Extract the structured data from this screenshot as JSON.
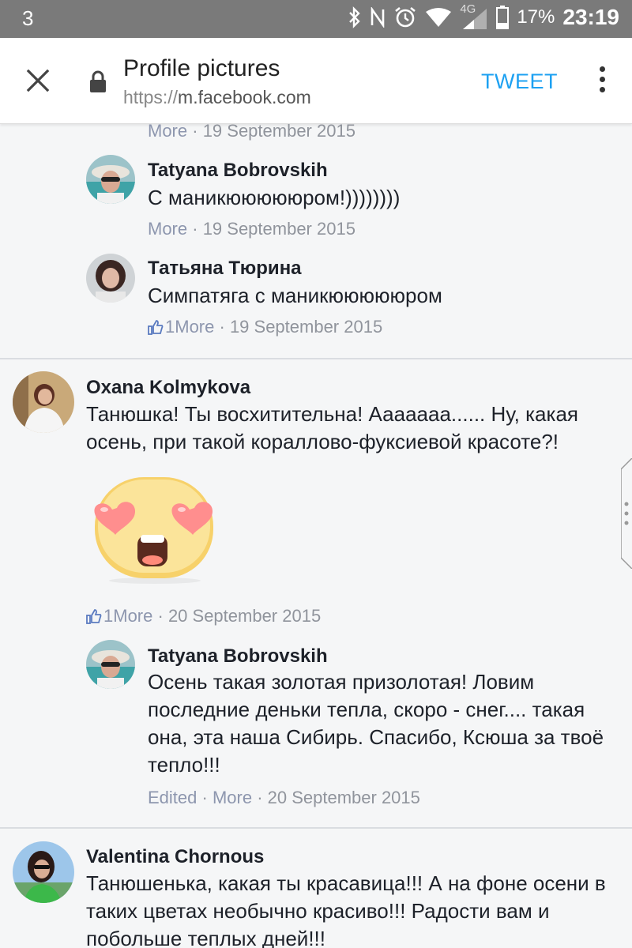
{
  "status_bar": {
    "notification_count": "3",
    "network": "4G",
    "battery": "17%",
    "time": "23:19"
  },
  "toolbar": {
    "title": "Profile pictures",
    "url_scheme": "https://",
    "url_host": "m.facebook.com",
    "tweet_label": "TWEET"
  },
  "comments": [
    {
      "meta_more": "More",
      "meta_date": "19 September 2015"
    },
    {
      "author": "Tatyana Bobrovskih",
      "text": "С маникюююююром!))))))))",
      "meta_more": "More",
      "meta_date": "19 September 2015"
    },
    {
      "author": "Татьяна Тюрина",
      "text": "Симпатяга с маникюююююром",
      "likes": "1",
      "meta_more": "More",
      "meta_date": "19 September 2015"
    },
    {
      "author": "Oxana Kolmykova",
      "text": "Танюшка! Ты восхитительна! Ааааааа...... Ну, какая осень, при такой кораллово-фуксиевой красоте?!",
      "sticker": "heart-eyes-emoji",
      "likes": "1",
      "meta_more": "More",
      "meta_date": "20 September 2015"
    },
    {
      "author": "Tatyana Bobrovskih",
      "text": "Осень такая золотая призолотая! Ловим последние деньки тепла, скоро - снег.... такая она, эта наша Сибирь. Спасибо, Ксюша за твоё тепло!!!",
      "meta_edited": "Edited",
      "meta_more": "More",
      "meta_date": "20 September 2015"
    },
    {
      "author": "Valentina Chornous",
      "text": "Танюшенька, какая ты красавица!!! А на фоне осени в таких цветах необычно красиво!!! Радости вам и побольше теплых дней!!!"
    }
  ],
  "colors": {
    "status_bar": "#7a7a7a",
    "link_blue": "#1da1f2",
    "meta_gray": "#90949c",
    "background": "#f5f6f7"
  }
}
